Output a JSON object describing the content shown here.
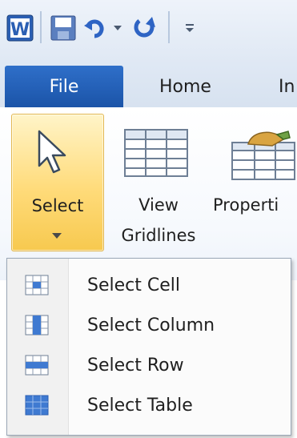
{
  "quick_access": {
    "app_icon": "word-icon",
    "save": "save-icon",
    "undo": "undo-icon",
    "redo": "redo-icon",
    "customize": "customize-qat-icon"
  },
  "tabs": [
    {
      "label": "File",
      "active": true
    },
    {
      "label": "Home"
    },
    {
      "label": "In"
    }
  ],
  "ribbon": {
    "select": {
      "label": "Select",
      "icon": "pointer-icon"
    },
    "view_gridlines": {
      "line1": "View",
      "line2": "Gridlines",
      "icon": "table-grid-icon"
    },
    "properties": {
      "label": "Properti",
      "icon": "properties-icon"
    }
  },
  "menu": {
    "items": [
      {
        "label": "Select Cell",
        "icon": "select-cell-icon"
      },
      {
        "label": "Select Column",
        "icon": "select-column-icon"
      },
      {
        "label": "Select Row",
        "icon": "select-row-icon"
      },
      {
        "label": "Select Table",
        "icon": "select-table-icon"
      }
    ]
  },
  "colors": {
    "file_tab": "#1b54a8",
    "select_highlight": "#ffdb7a",
    "menu_border": "#9aa7b7"
  }
}
